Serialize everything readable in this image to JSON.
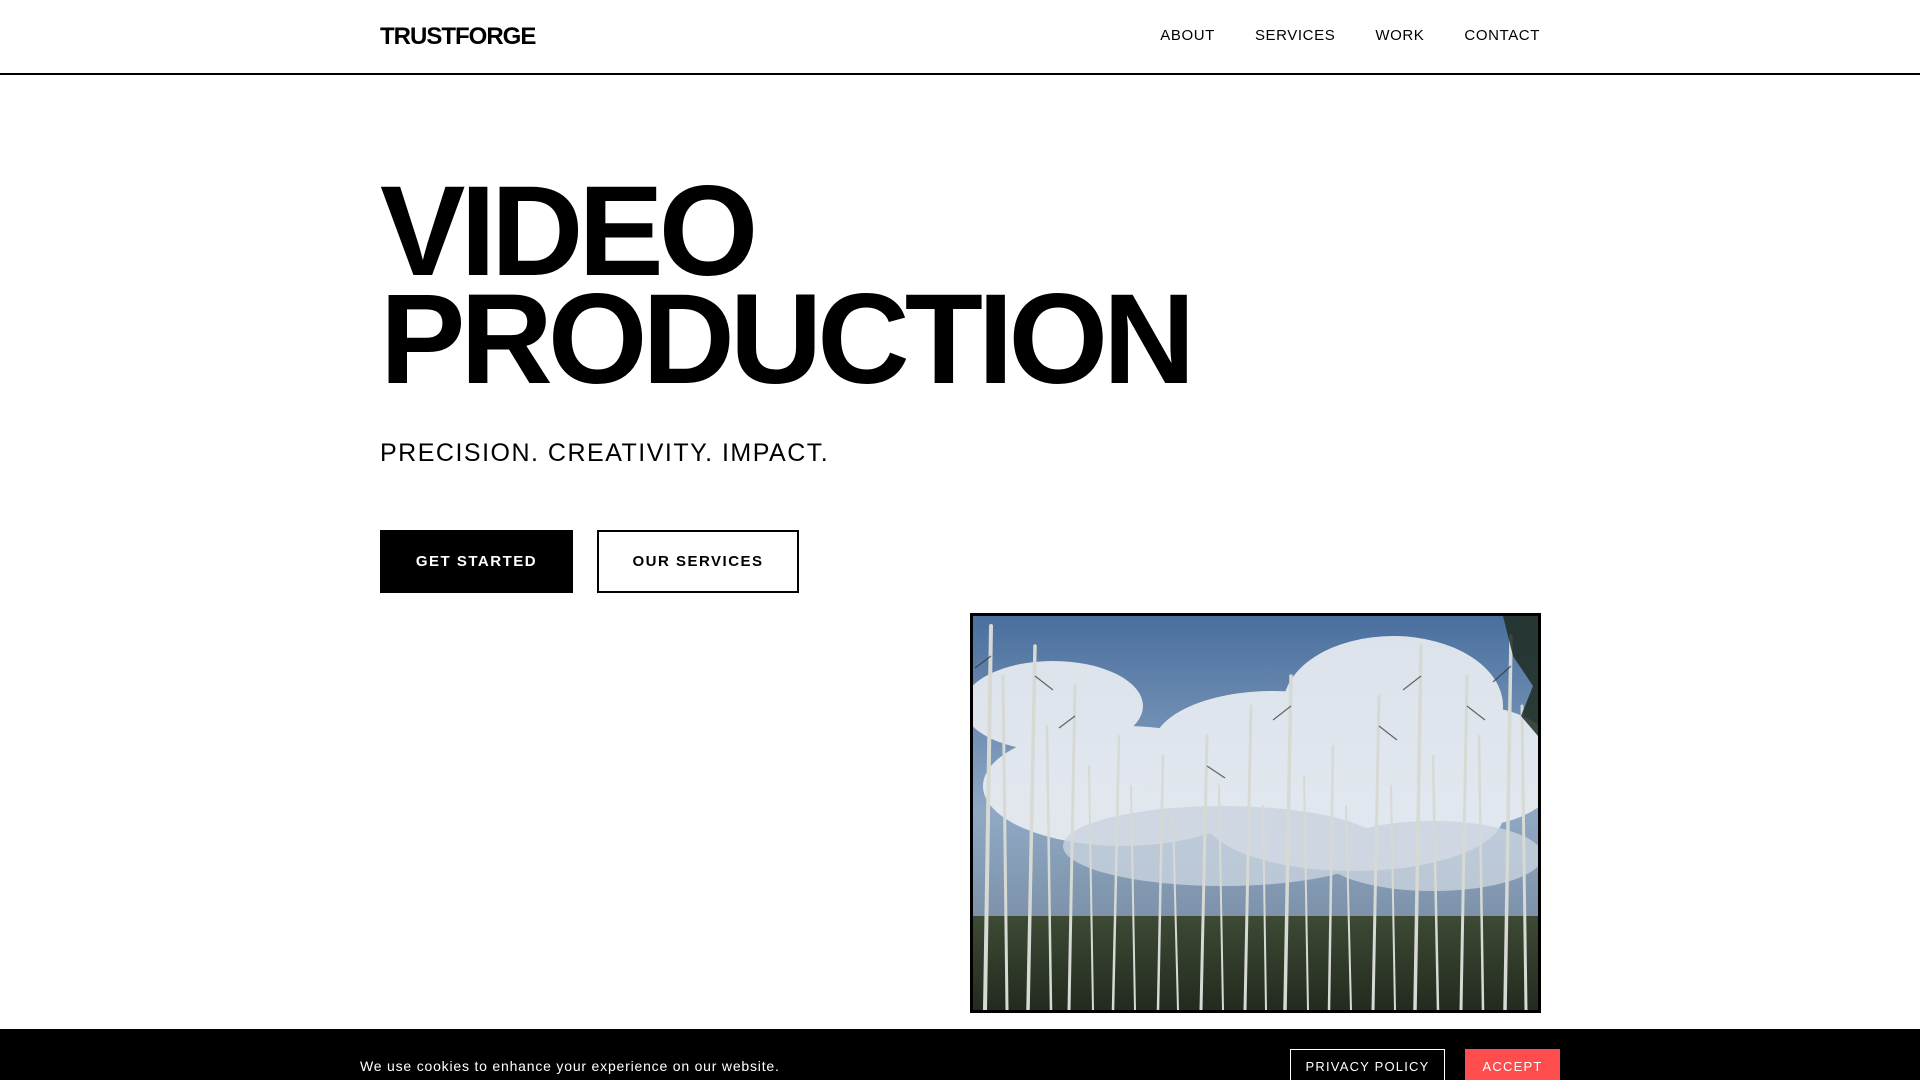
{
  "brand": {
    "logo_text": "TRUSTFORGE"
  },
  "nav": {
    "items": [
      {
        "label": "ABOUT"
      },
      {
        "label": "SERVICES"
      },
      {
        "label": "WORK"
      },
      {
        "label": "CONTACT"
      }
    ]
  },
  "hero": {
    "title_line_1": "VIDEO",
    "title_line_2": "PRODUCTION",
    "tagline": "PRECISION. CREATIVITY. IMPACT.",
    "primary_cta": "GET STARTED",
    "secondary_cta": "OUR SERVICES"
  },
  "media": {
    "image_subject": "forest-of-dead-trees-under-cloudy-sky"
  },
  "cookie_banner": {
    "message": "We use cookies to enhance your experience on our website.",
    "policy_label": "PRIVACY POLICY",
    "accept_label": "ACCEPT"
  },
  "colors": {
    "background": "#ffffff",
    "text": "#000000",
    "accent": "#ff4d4d",
    "banner": "#000000"
  }
}
